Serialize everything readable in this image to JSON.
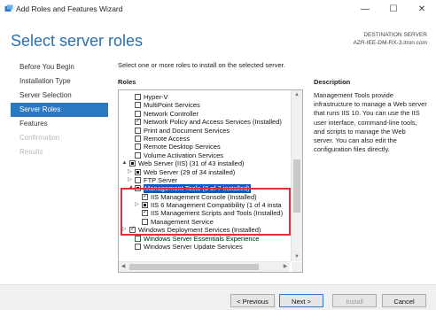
{
  "window": {
    "title": "Add Roles and Features Wizard",
    "minimize": "—",
    "maximize": "☐",
    "close": "✕"
  },
  "header": {
    "page_title": "Select server roles",
    "destination_label": "DESTINATION SERVER",
    "destination_value": "AZR-IEE-DM-RX-3.itron.com"
  },
  "nav": {
    "items": [
      {
        "label": "Before You Begin",
        "state": "normal"
      },
      {
        "label": "Installation Type",
        "state": "normal"
      },
      {
        "label": "Server Selection",
        "state": "normal"
      },
      {
        "label": "Server Roles",
        "state": "active"
      },
      {
        "label": "Features",
        "state": "normal"
      },
      {
        "label": "Confirmation",
        "state": "disabled"
      },
      {
        "label": "Results",
        "state": "disabled"
      }
    ]
  },
  "main": {
    "instruction": "Select one or more roles to install on the selected server.",
    "roles_label": "Roles",
    "description_label": "Description",
    "description_text": "Management Tools provide infrastructure to manage a Web server that runs IIS 10. You can use the IIS user interface, command-line tools, and scripts to manage the Web server. You can also edit the configuration files directly."
  },
  "roles": [
    {
      "label": "Hyper-V",
      "check": "none",
      "indent": 1,
      "expander": ""
    },
    {
      "label": "MultiPoint Services",
      "check": "none",
      "indent": 1,
      "expander": ""
    },
    {
      "label": "Network Controller",
      "check": "none",
      "indent": 1,
      "expander": ""
    },
    {
      "label": "Network Policy and Access Services (Installed)",
      "check": "checked",
      "indent": 1,
      "expander": ""
    },
    {
      "label": "Print and Document Services",
      "check": "none",
      "indent": 1,
      "expander": ""
    },
    {
      "label": "Remote Access",
      "check": "none",
      "indent": 1,
      "expander": ""
    },
    {
      "label": "Remote Desktop Services",
      "check": "none",
      "indent": 1,
      "expander": ""
    },
    {
      "label": "Volume Activation Services",
      "check": "none",
      "indent": 1,
      "expander": ""
    },
    {
      "label": "Web Server (IIS) (31 of 43 installed)",
      "check": "partial",
      "indent": 0,
      "expander": "▲"
    },
    {
      "label": "Web Server (29 of 34 installed)",
      "check": "partial",
      "indent": 1,
      "expander": "▷"
    },
    {
      "label": "FTP Server",
      "check": "none",
      "indent": 1,
      "expander": "▷"
    },
    {
      "label": "Management Tools (3 of 7 installed)",
      "check": "partial",
      "indent": 1,
      "expander": "◢",
      "selected": true
    },
    {
      "label": "IIS Management Console (Installed)",
      "check": "checked",
      "indent": 2,
      "expander": ""
    },
    {
      "label": "IIS 6 Management Compatibility (1 of 4 insta",
      "check": "partial",
      "indent": 2,
      "expander": "▷"
    },
    {
      "label": "IIS Management Scripts and Tools (Installed)",
      "check": "checked",
      "indent": 2,
      "expander": ""
    },
    {
      "label": "Management Service",
      "check": "none",
      "indent": 2,
      "expander": ""
    },
    {
      "label": "Windows Deployment Services (Installed)",
      "check": "checked",
      "indent": 0,
      "expander": "▷"
    },
    {
      "label": "Windows Server Essentials Experience",
      "check": "none",
      "indent": 1,
      "expander": ""
    },
    {
      "label": "Windows Server Update Services",
      "check": "none",
      "indent": 1,
      "expander": ""
    }
  ],
  "footer": {
    "previous": "< Previous",
    "next": "Next >",
    "install": "Install",
    "cancel": "Cancel"
  }
}
